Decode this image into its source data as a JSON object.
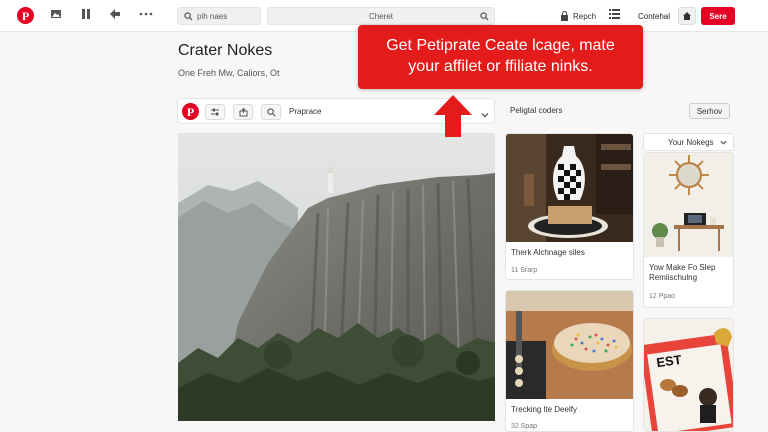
{
  "topbar": {
    "search_placeholder": "pih naes",
    "center_search": "Cheret",
    "apps_label": "Repch",
    "control_label": "Contehal",
    "save_label": "Sere"
  },
  "board": {
    "title": "Crater Nokes",
    "subtitle": "One Freh Mw, Caliors, Ot",
    "prepare_label": "Praprace"
  },
  "callout": {
    "line1": "Get Petiprate Ceate lcage, mate",
    "line2": "your affilet or ffiliate ninks."
  },
  "related": {
    "title": "Peligtal coders",
    "button": "Serhov",
    "your_notes": "Your Nokegs"
  },
  "cards": [
    {
      "title": "Therk Alchnage siles",
      "meta": "11 Srarp"
    },
    {
      "title": "Yow Make Fo Slep",
      "title2": "Remiischulng",
      "meta": "12 Ppao"
    },
    {
      "title": "Trecking lte Deelfy",
      "meta": "32 Spap"
    }
  ],
  "colors": {
    "accent": "#e60023",
    "callout": "#e31b1b"
  }
}
